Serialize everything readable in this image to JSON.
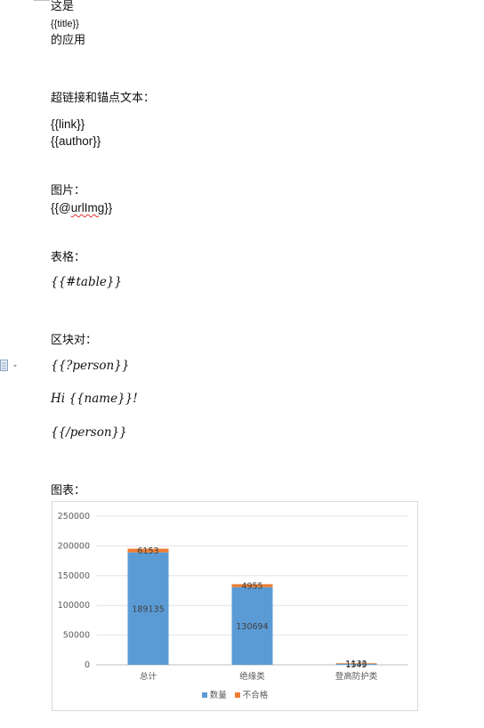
{
  "doc": {
    "intro_line1": "这是",
    "intro_title": "{{title}}",
    "intro_line3": "的应用",
    "link_heading": "超链接和锚点文本：",
    "link_tag": "{{link}}",
    "author_tag": "{{author}}",
    "image_heading": "图片：",
    "image_tag_prefix": "{{@",
    "image_tag_word": "urlImg",
    "image_tag_suffix": "}}",
    "table_heading": "表格：",
    "table_tag": "{{#table}}",
    "block_heading": "区块对：",
    "person_open": "{{?person}}",
    "greeting": "Hi {{name}}!",
    "person_close": "{{/person}}",
    "chart_heading": "图表："
  },
  "icons": {
    "margin": "paste-options-icon"
  },
  "chart_data": {
    "type": "bar",
    "stacked": true,
    "categories": [
      "总计",
      "绝缘类",
      "登高防护类"
    ],
    "series": [
      {
        "name": "数量",
        "values": [
          189135,
          130694,
          1549
        ],
        "color": "#5b9bd5"
      },
      {
        "name": "不合格",
        "values": [
          6153,
          4955,
          1133
        ],
        "color": "#ed7d31"
      }
    ],
    "ylim": [
      0,
      250000
    ],
    "yticks": [
      0,
      50000,
      100000,
      150000,
      200000,
      250000
    ],
    "grid": true,
    "legend": "bottom",
    "data_labels": true
  }
}
